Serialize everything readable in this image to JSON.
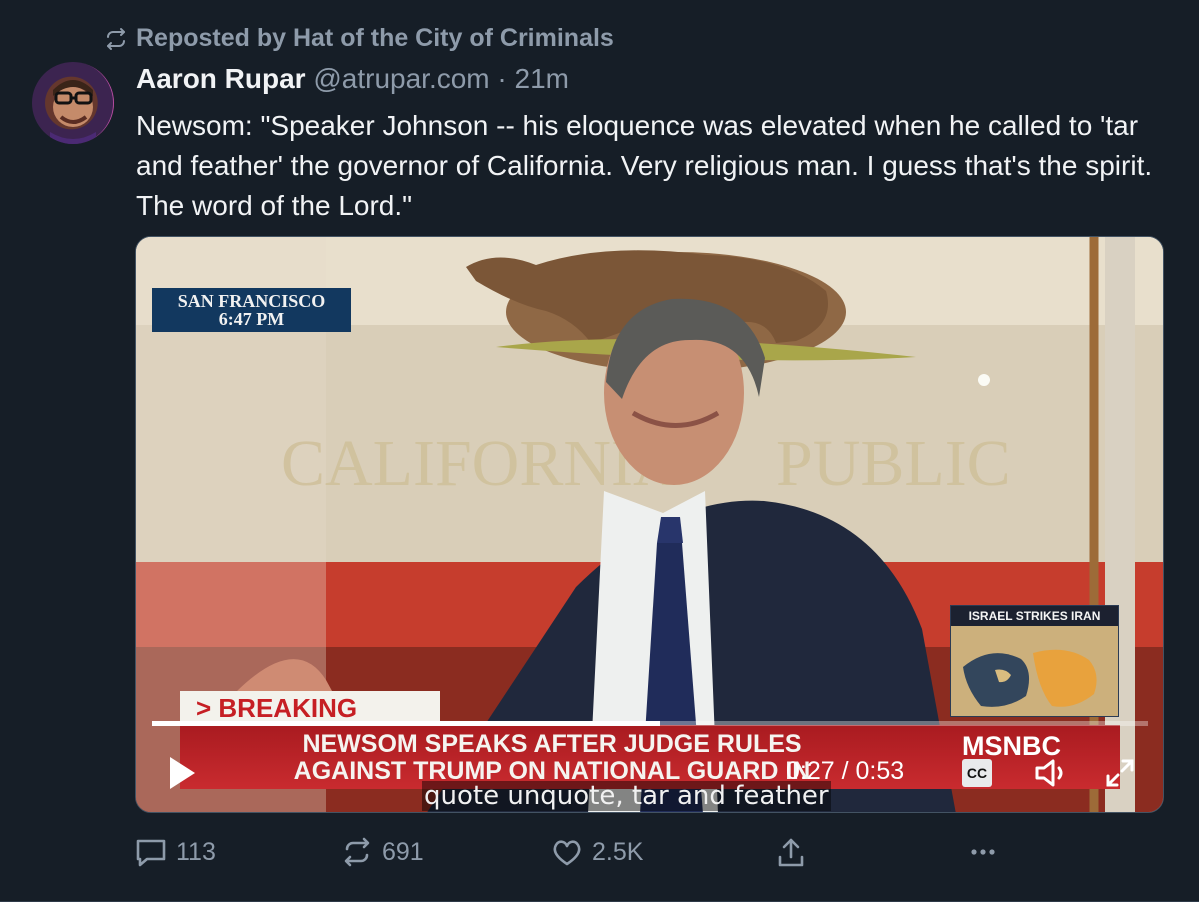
{
  "repost": {
    "label": "Reposted by Hat of the City of Criminals"
  },
  "post": {
    "author": "Aaron Rupar",
    "handle": "@atrupar.com",
    "separator": "·",
    "time": "21m",
    "text": "Newsom: \"Speaker Johnson -- his eloquence was elevated when he called to 'tar and feather' the governor of California. Very religious man. I guess that's the spirit. The word of the Lord.\""
  },
  "video": {
    "location": "SAN FRANCISCO",
    "clock": "6:47 PM",
    "map_title": "ISRAEL STRIKES IRAN",
    "breaking": "> BREAKING NEWS",
    "headline_line1": "NEWSOM SPEAKS AFTER JUDGE RULES",
    "headline_line2": "AGAINST TRUMP ON NATIONAL GUARD IN",
    "network": "MSNBC",
    "caption": "quote unquote, tar and feather",
    "current_time": "0:27",
    "duration": "0:53",
    "time_separator": "/",
    "progress_fraction": 0.51,
    "cc_label": "CC"
  },
  "actions": {
    "replies": "113",
    "reposts": "691",
    "likes": "2.5K"
  },
  "colors": {
    "background": "#161e27",
    "muted_text": "#8e9baa",
    "text": "#f1f3f5",
    "breaking_red": "#c61f24"
  },
  "icons": {
    "repost": "repost-icon",
    "reply": "reply-icon",
    "like": "heart-icon",
    "share": "share-icon",
    "more": "more-icon"
  }
}
